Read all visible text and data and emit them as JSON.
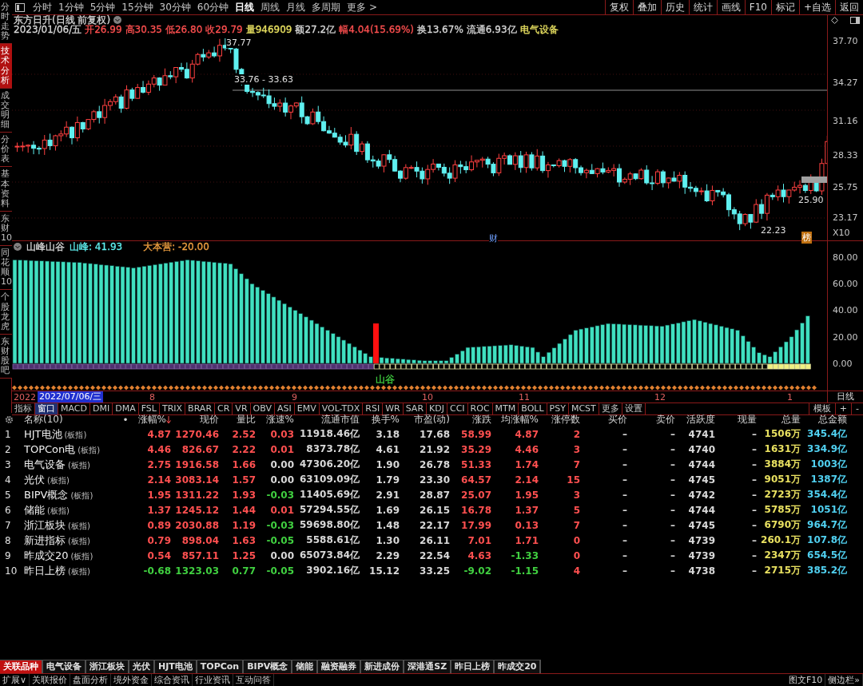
{
  "sidebar": {
    "items": [
      {
        "label": "分时走势",
        "selected": false
      },
      {
        "label": "技术分析",
        "selected": true
      },
      {
        "label": "成交明细",
        "selected": false
      },
      {
        "label": "分价表",
        "selected": false
      },
      {
        "label": "基本资料",
        "selected": false
      },
      {
        "label": "东财10",
        "selected": false
      },
      {
        "label": "同花顺10",
        "selected": false
      },
      {
        "label": "个股龙虎",
        "selected": false
      },
      {
        "label": "东财股吧",
        "selected": false
      }
    ]
  },
  "periods": [
    {
      "label": "分时",
      "selected": false
    },
    {
      "label": "1分钟",
      "selected": false
    },
    {
      "label": "5分钟",
      "selected": false
    },
    {
      "label": "15分钟",
      "selected": false
    },
    {
      "label": "30分钟",
      "selected": false
    },
    {
      "label": "60分钟",
      "selected": false
    },
    {
      "label": "日线",
      "selected": true
    },
    {
      "label": "周线",
      "selected": false
    },
    {
      "label": "月线",
      "selected": false
    },
    {
      "label": "多周期",
      "selected": false
    },
    {
      "label": "更多 >",
      "selected": false
    }
  ],
  "tools": [
    "复权",
    "叠加",
    "历史",
    "统计",
    "画线",
    "F10",
    "标记",
    "+自选",
    "返回"
  ],
  "stock_title": "东方日升(日线 前复权)",
  "quote": [
    {
      "text": "2023/01/06/五",
      "color": "#d8d8d8"
    },
    {
      "text": "开26.99",
      "color": "#ff5050"
    },
    {
      "text": "高30.35",
      "color": "#ff5050"
    },
    {
      "text": "低26.80",
      "color": "#ff5050"
    },
    {
      "text": "收29.79",
      "color": "#ff5050"
    },
    {
      "text": "量946909",
      "color": "#e8e060"
    },
    {
      "text": "额27.2亿",
      "color": "#d8d8d8"
    },
    {
      "text": "幅4.04(15.69%)",
      "color": "#ff5050"
    },
    {
      "text": "换13.67%",
      "color": "#d8d8d8"
    },
    {
      "text": "流通6.93亿",
      "color": "#d8d8d8"
    },
    {
      "text": "电气设备",
      "color": "#e8e060"
    }
  ],
  "price_axis": [
    "37.70",
    "34.27",
    "31.16",
    "28.33",
    "25.75",
    "23.17"
  ],
  "price_notes": [
    {
      "text": "37.77",
      "kind": "plain"
    },
    {
      "text": "33.76 - 33.63",
      "kind": "plain"
    },
    {
      "text": "25.90",
      "kind": "plain"
    },
    {
      "text": "22.23",
      "kind": "plain"
    },
    {
      "text": "财",
      "kind": "news"
    },
    {
      "text": "榜",
      "kind": "badge"
    }
  ],
  "zoom_label": "X10",
  "indicator": {
    "name": "山峰山谷",
    "value_label": "山峰: 41.93",
    "base_label": "大本营: -20.00",
    "axis": [
      "80.00",
      "60.00",
      "40.00",
      "20.00",
      "0.00"
    ],
    "valley_label": "山谷"
  },
  "date_axis": {
    "year": "2022",
    "cursor": "2022/07/06/三",
    "months": [
      "8",
      "9",
      "10",
      "11",
      "12",
      "1"
    ],
    "period": "日线"
  },
  "indicator_tabs": [
    {
      "label": "指标",
      "selected": false
    },
    {
      "label": "窗口",
      "selected": true
    },
    {
      "label": "MACD",
      "selected": false
    },
    {
      "label": "DMI",
      "selected": false
    },
    {
      "label": "DMA",
      "selected": false
    },
    {
      "label": "FSL",
      "selected": false
    },
    {
      "label": "TRIX",
      "selected": false
    },
    {
      "label": "BRAR",
      "selected": false
    },
    {
      "label": "CR",
      "selected": false
    },
    {
      "label": "VR",
      "selected": false
    },
    {
      "label": "OBV",
      "selected": false
    },
    {
      "label": "ASI",
      "selected": false
    },
    {
      "label": "EMV",
      "selected": false
    },
    {
      "label": "VOL-TDX",
      "selected": false
    },
    {
      "label": "RSI",
      "selected": false
    },
    {
      "label": "WR",
      "selected": false
    },
    {
      "label": "SAR",
      "selected": false
    },
    {
      "label": "KDJ",
      "selected": false
    },
    {
      "label": "CCI",
      "selected": false
    },
    {
      "label": "ROC",
      "selected": false
    },
    {
      "label": "MTM",
      "selected": false
    },
    {
      "label": "BOLL",
      "selected": false
    },
    {
      "label": "PSY",
      "selected": false
    },
    {
      "label": "MCST",
      "selected": false
    },
    {
      "label": "更多",
      "selected": false
    },
    {
      "label": "设置",
      "selected": false
    }
  ],
  "template_buttons": [
    "模板",
    "+",
    "-"
  ],
  "table": {
    "sort_dot": "•",
    "columns": [
      {
        "label": "名称(10)",
        "sorted": false
      },
      {
        "label": "涨幅%",
        "sorted": true
      },
      {
        "label": "现价",
        "sorted": false
      },
      {
        "label": "量比",
        "sorted": false
      },
      {
        "label": "涨速%",
        "sorted": false
      },
      {
        "label": "流通市值",
        "sorted": false
      },
      {
        "label": "换手%",
        "sorted": false
      },
      {
        "label": "市盈(动)",
        "sorted": false
      },
      {
        "label": "涨跌",
        "sorted": false
      },
      {
        "label": "均涨幅%",
        "sorted": false
      },
      {
        "label": "涨停数",
        "sorted": false
      },
      {
        "label": "买价",
        "sorted": false
      },
      {
        "label": "卖价",
        "sorted": false
      },
      {
        "label": "活跃度",
        "sorted": false
      },
      {
        "label": "现量",
        "sorted": false
      },
      {
        "label": "总量",
        "sorted": false
      },
      {
        "label": "总金额",
        "sorted": false
      }
    ],
    "rows": [
      {
        "rank": "1",
        "cells": [
          {
            "text": "HJT电池",
            "tag": "(板指)"
          },
          {
            "text": "4.87",
            "color": "#ff5050"
          },
          {
            "text": "1270.46",
            "color": "#ff5050"
          },
          {
            "text": "2.52",
            "color": "#ff5050"
          },
          {
            "text": "0.03",
            "color": "#ff5050"
          },
          {
            "text": "11918.46亿",
            "color": "#d8d8d8"
          },
          {
            "text": "3.18",
            "color": "#d8d8d8"
          },
          {
            "text": "17.68",
            "color": "#d8d8d8"
          },
          {
            "text": "58.99",
            "color": "#ff5050"
          },
          {
            "text": "4.87",
            "color": "#ff5050"
          },
          {
            "text": "2",
            "color": "#ff5050"
          },
          {
            "text": "–",
            "color": "#d8d8d8"
          },
          {
            "text": "–",
            "color": "#d8d8d8"
          },
          {
            "text": "4741",
            "color": "#d8d8d8"
          },
          {
            "text": "–",
            "color": "#d8d8d8"
          },
          {
            "text": "1506万",
            "color": "#e8e060"
          },
          {
            "text": "345.4亿",
            "color": "#50d0f0"
          }
        ]
      },
      {
        "rank": "2",
        "cells": [
          {
            "text": "TOPCon电",
            "tag": "(板指)"
          },
          {
            "text": "4.46",
            "color": "#ff5050"
          },
          {
            "text": "826.67",
            "color": "#ff5050"
          },
          {
            "text": "2.22",
            "color": "#ff5050"
          },
          {
            "text": "0.01",
            "color": "#ff5050"
          },
          {
            "text": "8373.78亿",
            "color": "#d8d8d8"
          },
          {
            "text": "4.61",
            "color": "#d8d8d8"
          },
          {
            "text": "21.92",
            "color": "#d8d8d8"
          },
          {
            "text": "35.29",
            "color": "#ff5050"
          },
          {
            "text": "4.46",
            "color": "#ff5050"
          },
          {
            "text": "3",
            "color": "#ff5050"
          },
          {
            "text": "–",
            "color": "#d8d8d8"
          },
          {
            "text": "–",
            "color": "#d8d8d8"
          },
          {
            "text": "4740",
            "color": "#d8d8d8"
          },
          {
            "text": "–",
            "color": "#d8d8d8"
          },
          {
            "text": "1631万",
            "color": "#e8e060"
          },
          {
            "text": "334.9亿",
            "color": "#50d0f0"
          }
        ]
      },
      {
        "rank": "3",
        "cells": [
          {
            "text": "电气设备",
            "tag": "(板指)"
          },
          {
            "text": "2.75",
            "color": "#ff5050"
          },
          {
            "text": "1916.58",
            "color": "#ff5050"
          },
          {
            "text": "1.66",
            "color": "#ff5050"
          },
          {
            "text": "0.00",
            "color": "#d8d8d8"
          },
          {
            "text": "47306.20亿",
            "color": "#d8d8d8"
          },
          {
            "text": "1.90",
            "color": "#d8d8d8"
          },
          {
            "text": "26.78",
            "color": "#d8d8d8"
          },
          {
            "text": "51.33",
            "color": "#ff5050"
          },
          {
            "text": "1.74",
            "color": "#ff5050"
          },
          {
            "text": "7",
            "color": "#ff5050"
          },
          {
            "text": "–",
            "color": "#d8d8d8"
          },
          {
            "text": "–",
            "color": "#d8d8d8"
          },
          {
            "text": "4744",
            "color": "#d8d8d8"
          },
          {
            "text": "–",
            "color": "#d8d8d8"
          },
          {
            "text": "3884万",
            "color": "#e8e060"
          },
          {
            "text": "1003亿",
            "color": "#50d0f0"
          }
        ]
      },
      {
        "rank": "4",
        "cells": [
          {
            "text": "光伏",
            "tag": "(板指)"
          },
          {
            "text": "2.14",
            "color": "#ff5050"
          },
          {
            "text": "3083.14",
            "color": "#ff5050"
          },
          {
            "text": "1.57",
            "color": "#ff5050"
          },
          {
            "text": "0.00",
            "color": "#d8d8d8"
          },
          {
            "text": "63109.09亿",
            "color": "#d8d8d8"
          },
          {
            "text": "1.79",
            "color": "#d8d8d8"
          },
          {
            "text": "23.30",
            "color": "#d8d8d8"
          },
          {
            "text": "64.57",
            "color": "#ff5050"
          },
          {
            "text": "2.14",
            "color": "#ff5050"
          },
          {
            "text": "15",
            "color": "#ff5050"
          },
          {
            "text": "–",
            "color": "#d8d8d8"
          },
          {
            "text": "–",
            "color": "#d8d8d8"
          },
          {
            "text": "4745",
            "color": "#d8d8d8"
          },
          {
            "text": "–",
            "color": "#d8d8d8"
          },
          {
            "text": "9051万",
            "color": "#e8e060"
          },
          {
            "text": "1387亿",
            "color": "#50d0f0"
          }
        ]
      },
      {
        "rank": "5",
        "cells": [
          {
            "text": "BIPV概念",
            "tag": "(板指)"
          },
          {
            "text": "1.95",
            "color": "#ff5050"
          },
          {
            "text": "1311.22",
            "color": "#ff5050"
          },
          {
            "text": "1.93",
            "color": "#ff5050"
          },
          {
            "text": "-0.03",
            "color": "#40d040"
          },
          {
            "text": "11405.69亿",
            "color": "#d8d8d8"
          },
          {
            "text": "2.91",
            "color": "#d8d8d8"
          },
          {
            "text": "28.87",
            "color": "#d8d8d8"
          },
          {
            "text": "25.07",
            "color": "#ff5050"
          },
          {
            "text": "1.95",
            "color": "#ff5050"
          },
          {
            "text": "3",
            "color": "#ff5050"
          },
          {
            "text": "–",
            "color": "#d8d8d8"
          },
          {
            "text": "–",
            "color": "#d8d8d8"
          },
          {
            "text": "4742",
            "color": "#d8d8d8"
          },
          {
            "text": "–",
            "color": "#d8d8d8"
          },
          {
            "text": "2723万",
            "color": "#e8e060"
          },
          {
            "text": "354.4亿",
            "color": "#50d0f0"
          }
        ]
      },
      {
        "rank": "6",
        "cells": [
          {
            "text": "储能",
            "tag": "(板指)"
          },
          {
            "text": "1.37",
            "color": "#ff5050"
          },
          {
            "text": "1245.12",
            "color": "#ff5050"
          },
          {
            "text": "1.44",
            "color": "#ff5050"
          },
          {
            "text": "0.01",
            "color": "#ff5050"
          },
          {
            "text": "57294.55亿",
            "color": "#d8d8d8"
          },
          {
            "text": "1.69",
            "color": "#d8d8d8"
          },
          {
            "text": "26.15",
            "color": "#d8d8d8"
          },
          {
            "text": "16.78",
            "color": "#ff5050"
          },
          {
            "text": "1.37",
            "color": "#ff5050"
          },
          {
            "text": "5",
            "color": "#ff5050"
          },
          {
            "text": "–",
            "color": "#d8d8d8"
          },
          {
            "text": "–",
            "color": "#d8d8d8"
          },
          {
            "text": "4744",
            "color": "#d8d8d8"
          },
          {
            "text": "–",
            "color": "#d8d8d8"
          },
          {
            "text": "5785万",
            "color": "#e8e060"
          },
          {
            "text": "1051亿",
            "color": "#50d0f0"
          }
        ]
      },
      {
        "rank": "7",
        "cells": [
          {
            "text": "浙江板块",
            "tag": "(板指)"
          },
          {
            "text": "0.89",
            "color": "#ff5050"
          },
          {
            "text": "2030.88",
            "color": "#ff5050"
          },
          {
            "text": "1.19",
            "color": "#ff5050"
          },
          {
            "text": "-0.03",
            "color": "#40d040"
          },
          {
            "text": "59698.80亿",
            "color": "#d8d8d8"
          },
          {
            "text": "1.48",
            "color": "#d8d8d8"
          },
          {
            "text": "22.17",
            "color": "#d8d8d8"
          },
          {
            "text": "17.99",
            "color": "#ff5050"
          },
          {
            "text": "0.13",
            "color": "#ff5050"
          },
          {
            "text": "7",
            "color": "#ff5050"
          },
          {
            "text": "–",
            "color": "#d8d8d8"
          },
          {
            "text": "–",
            "color": "#d8d8d8"
          },
          {
            "text": "4745",
            "color": "#d8d8d8"
          },
          {
            "text": "–",
            "color": "#d8d8d8"
          },
          {
            "text": "6790万",
            "color": "#e8e060"
          },
          {
            "text": "964.7亿",
            "color": "#50d0f0"
          }
        ]
      },
      {
        "rank": "8",
        "cells": [
          {
            "text": "新进指标",
            "tag": "(板指)"
          },
          {
            "text": "0.79",
            "color": "#ff5050"
          },
          {
            "text": "898.04",
            "color": "#ff5050"
          },
          {
            "text": "1.63",
            "color": "#ff5050"
          },
          {
            "text": "-0.05",
            "color": "#40d040"
          },
          {
            "text": "5588.61亿",
            "color": "#d8d8d8"
          },
          {
            "text": "1.30",
            "color": "#d8d8d8"
          },
          {
            "text": "26.11",
            "color": "#d8d8d8"
          },
          {
            "text": "7.01",
            "color": "#ff5050"
          },
          {
            "text": "1.71",
            "color": "#ff5050"
          },
          {
            "text": "0",
            "color": "#ff5050"
          },
          {
            "text": "–",
            "color": "#d8d8d8"
          },
          {
            "text": "–",
            "color": "#d8d8d8"
          },
          {
            "text": "4739",
            "color": "#d8d8d8"
          },
          {
            "text": "–",
            "color": "#d8d8d8"
          },
          {
            "text": "260.1万",
            "color": "#e8e060"
          },
          {
            "text": "107.8亿",
            "color": "#50d0f0"
          }
        ]
      },
      {
        "rank": "9",
        "cells": [
          {
            "text": "昨成交20",
            "tag": "(板指)"
          },
          {
            "text": "0.54",
            "color": "#ff5050"
          },
          {
            "text": "857.11",
            "color": "#ff5050"
          },
          {
            "text": "1.25",
            "color": "#ff5050"
          },
          {
            "text": "0.00",
            "color": "#d8d8d8"
          },
          {
            "text": "65073.84亿",
            "color": "#d8d8d8"
          },
          {
            "text": "2.29",
            "color": "#d8d8d8"
          },
          {
            "text": "22.54",
            "color": "#d8d8d8"
          },
          {
            "text": "4.63",
            "color": "#ff5050"
          },
          {
            "text": "-1.33",
            "color": "#40d040"
          },
          {
            "text": "0",
            "color": "#ff5050"
          },
          {
            "text": "–",
            "color": "#d8d8d8"
          },
          {
            "text": "–",
            "color": "#d8d8d8"
          },
          {
            "text": "4739",
            "color": "#d8d8d8"
          },
          {
            "text": "–",
            "color": "#d8d8d8"
          },
          {
            "text": "2347万",
            "color": "#e8e060"
          },
          {
            "text": "654.5亿",
            "color": "#50d0f0"
          }
        ]
      },
      {
        "rank": "10",
        "cells": [
          {
            "text": "昨日上榜",
            "tag": "(板指)"
          },
          {
            "text": "-0.68",
            "color": "#40d040"
          },
          {
            "text": "1323.03",
            "color": "#40d040"
          },
          {
            "text": "0.77",
            "color": "#40d040"
          },
          {
            "text": "-0.05",
            "color": "#40d040"
          },
          {
            "text": "3902.16亿",
            "color": "#d8d8d8"
          },
          {
            "text": "15.12",
            "color": "#d8d8d8"
          },
          {
            "text": "33.25",
            "color": "#d8d8d8"
          },
          {
            "text": "-9.02",
            "color": "#40d040"
          },
          {
            "text": "-1.15",
            "color": "#40d040"
          },
          {
            "text": "4",
            "color": "#ff5050"
          },
          {
            "text": "–",
            "color": "#d8d8d8"
          },
          {
            "text": "–",
            "color": "#d8d8d8"
          },
          {
            "text": "4738",
            "color": "#d8d8d8"
          },
          {
            "text": "–",
            "color": "#d8d8d8"
          },
          {
            "text": "2715万",
            "color": "#e8e060"
          },
          {
            "text": "385.2亿",
            "color": "#50d0f0"
          }
        ]
      }
    ]
  },
  "bottom_tabs": [
    {
      "label": "关联品种",
      "selected": true
    },
    {
      "label": "电气设备",
      "selected": false
    },
    {
      "label": "浙江板块",
      "selected": false
    },
    {
      "label": "光伏",
      "selected": false
    },
    {
      "label": "HJT电池",
      "selected": false
    },
    {
      "label": "TOPCon",
      "selected": false
    },
    {
      "label": "BIPV概念",
      "selected": false
    },
    {
      "label": "储能",
      "selected": false
    },
    {
      "label": "融资融券",
      "selected": false
    },
    {
      "label": "新进成份",
      "selected": false
    },
    {
      "label": "深港通SZ",
      "selected": false
    },
    {
      "label": "昨日上榜",
      "selected": false
    },
    {
      "label": "昨成交20",
      "selected": false
    }
  ],
  "status_bar": {
    "left": [
      "扩展∨",
      "关联报价",
      "盘面分析",
      "境外资金",
      "综合资讯",
      "行业资讯",
      "互动问答"
    ],
    "right": [
      "图文F10",
      "侧边栏»"
    ]
  }
}
